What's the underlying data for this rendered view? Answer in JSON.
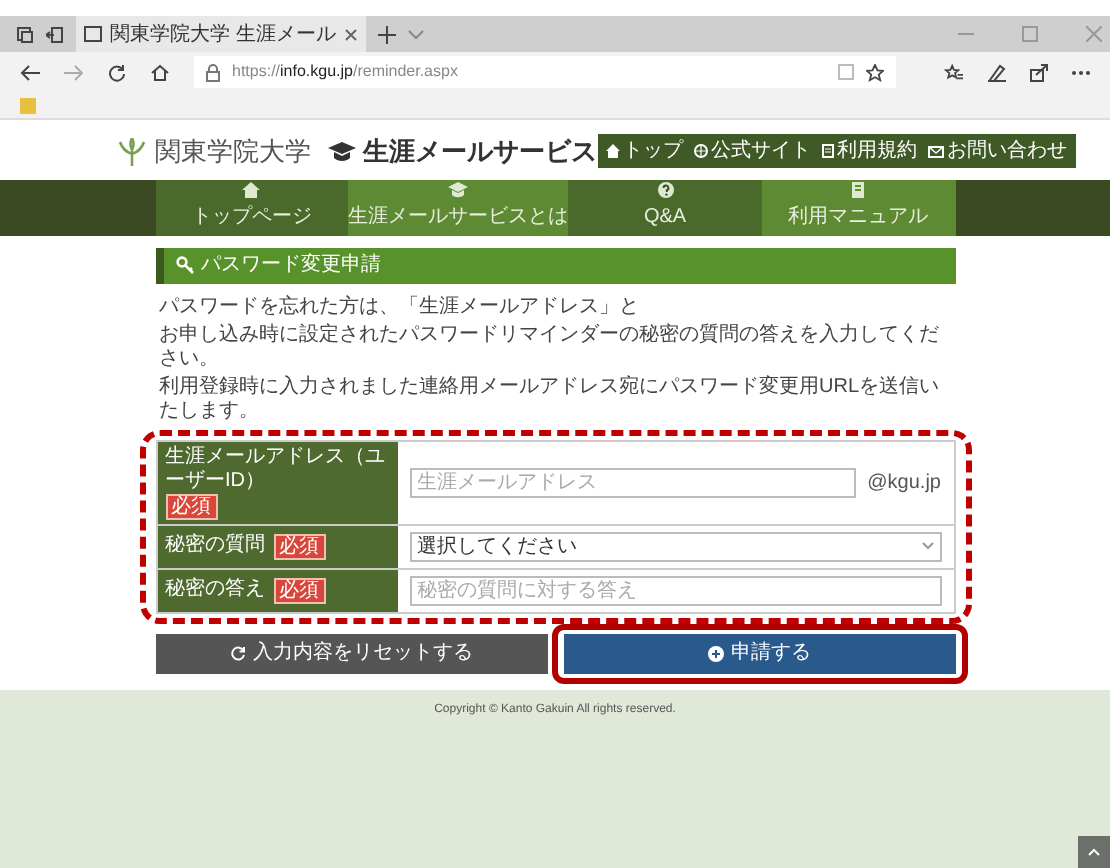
{
  "browser": {
    "tab_title": "関東学院大学 生涯メール",
    "url_prefix": "https://",
    "url_host": "info.kgu.jp",
    "url_path": "/reminder.aspx"
  },
  "header": {
    "university": "関東学院大学",
    "service": "生涯メールサービス",
    "links": [
      {
        "label": "トップ"
      },
      {
        "label": "公式サイト"
      },
      {
        "label": "利用規約"
      },
      {
        "label": "お問い合わせ"
      }
    ]
  },
  "nav": [
    {
      "label": "トップページ"
    },
    {
      "label": "生涯メールサービスとは"
    },
    {
      "label": "Q&A"
    },
    {
      "label": "利用マニュアル"
    }
  ],
  "panel": {
    "title": "パスワード変更申請",
    "intro": [
      "パスワードを忘れた方は、「生涯メールアドレス」と",
      "お申し込み時に設定されたパスワードリマインダーの秘密の質問の答えを入力してください。",
      "利用登録時に入力されました連絡用メールアドレス宛にパスワード変更用URLを送信いたします。"
    ],
    "fields": [
      {
        "kind": "text",
        "label": "生涯メールアドレス（ユーザーID）",
        "badge": "必須",
        "placeholder": "生涯メールアドレス",
        "suffix": "@kgu.jp"
      },
      {
        "kind": "select",
        "label": "秘密の質問",
        "badge": "必須",
        "value": "選択してください"
      },
      {
        "kind": "text",
        "label": "秘密の答え",
        "badge": "必須",
        "placeholder": "秘密の質問に対する答え"
      }
    ],
    "reset_button": "入力内容をリセットする",
    "submit_button": "申請する"
  },
  "footer": {
    "copyright": "Copyright © Kanto Gakuin All rights reserved."
  }
}
